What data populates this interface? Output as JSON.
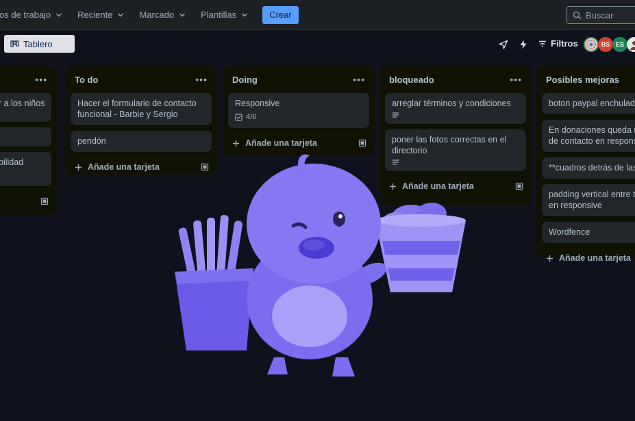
{
  "topnav": {
    "menus": [
      {
        "label": "os de trabajo"
      },
      {
        "label": "Reciente"
      },
      {
        "label": "Marcado"
      },
      {
        "label": "Plantillas"
      }
    ],
    "create_label": "Crear",
    "search_placeholder": "Buscar"
  },
  "boardbar": {
    "view_label": "Tablero",
    "filters_label": "Filtros",
    "avatars": [
      {
        "initials": "",
        "color": "#4f8c6a"
      },
      {
        "initials": "BS",
        "color": "#d63f2c"
      },
      {
        "initials": "ES",
        "color": "#1f845a"
      },
      {
        "initials": "",
        "color": "#e8e8e8"
      }
    ]
  },
  "lists": [
    {
      "title": "",
      "cards": [
        {
          "text": "r a los niños"
        },
        {
          "text": ""
        },
        {
          "text": "bilidad"
        }
      ],
      "add_label": ""
    },
    {
      "title": "To do",
      "cards": [
        {
          "text": "Hacer el formulario de contacto funcional - Barbie y Sergio"
        },
        {
          "text": "pendón"
        }
      ],
      "add_label": "Añade una tarjeta"
    },
    {
      "title": "Doing",
      "cards": [
        {
          "text": "Responsive",
          "checklist": "4/6"
        }
      ],
      "add_label": "Añade una tarjeta"
    },
    {
      "title": "bloqueado",
      "cards": [
        {
          "text": "arreglar términos y condiciones"
        },
        {
          "text": "poner las fotos correctas en el directorio"
        }
      ],
      "add_label": "Añade una tarjeta"
    },
    {
      "title": "Posibles mejoras",
      "cards": [
        {
          "text": "boton paypal enchulado"
        },
        {
          "text": "En donaciones queda mal",
          "text2": "de contacto en responsive"
        },
        {
          "text": "**cuadros detrás de las im"
        },
        {
          "text": "padding vertical entre tar",
          "text2": "en responsive"
        },
        {
          "text": "Wordfence"
        }
      ],
      "add_label": "Añade una tarjeta"
    }
  ],
  "colors": {
    "accent": "#579dff",
    "list_bg": "#101204",
    "card_bg": "#22272b",
    "mascot": "#7b6cf0"
  },
  "mascot": {
    "icon": "chick-mascot-with-fries-icon"
  }
}
